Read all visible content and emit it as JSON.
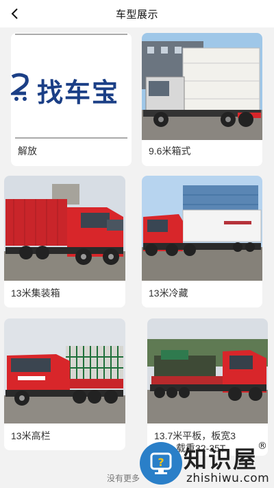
{
  "header": {
    "title": "车型展示"
  },
  "logo": {
    "text": "找车宝"
  },
  "cards": [
    {
      "label": "解放"
    },
    {
      "label": "9.6米箱式"
    },
    {
      "label": "13米集装箱"
    },
    {
      "label": "13米冷藏"
    },
    {
      "label": "13米高栏"
    },
    {
      "label": "13.7米平板，板宽3",
      "label2": "载重32-35T"
    }
  ],
  "footer": {
    "text": "没有更多"
  },
  "watermark": {
    "title": "知识屋",
    "reg": "®",
    "subtitle": "zhishiwu.com"
  },
  "colors": {
    "truck_red": "#d8262a",
    "watermark_blue": "#2a7fc8",
    "logo_blue": "#1b3f86"
  }
}
